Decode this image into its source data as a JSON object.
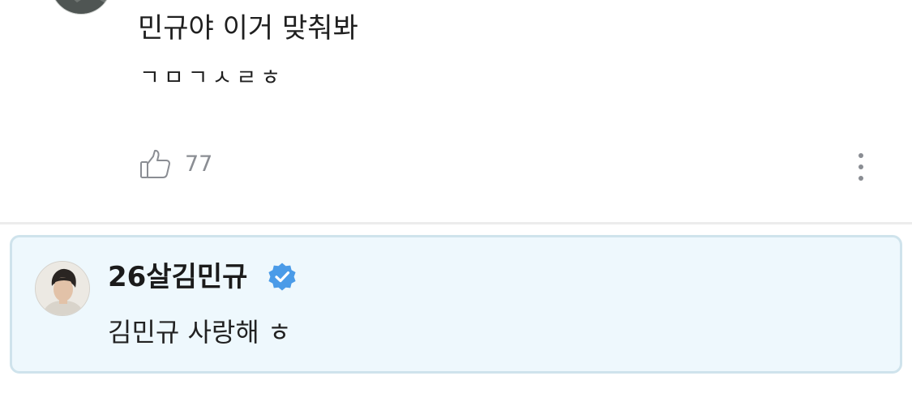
{
  "comment": {
    "avatar_icon": "user-avatar-icon",
    "text_line_1": "민규야 이거 맞춰봐",
    "text_line_2": "ㄱㅁㄱㅅㄹㅎ",
    "like_icon": "thumbs-up-icon",
    "like_count": "77",
    "more_icon": "vertical-ellipsis-icon"
  },
  "reply": {
    "author_name": "26살김민규",
    "verified_icon": "verified-badge-icon",
    "verified_color": "#4a9be8",
    "text": "김민규 사랑해 ㅎ",
    "background_color": "#eef8fd",
    "border_color": "#cfe3ec"
  }
}
